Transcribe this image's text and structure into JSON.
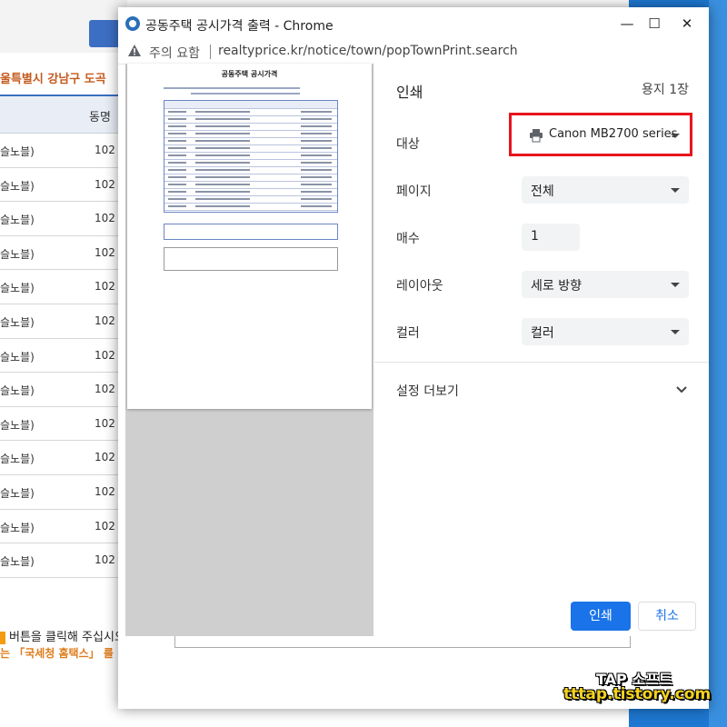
{
  "background_page": {
    "title_fragment": "울특별시 강남구 도곡",
    "table": {
      "header_col2": "동명",
      "rows": [
        {
          "c1": "슬노블)",
          "c2": "102"
        },
        {
          "c1": "슬노블)",
          "c2": "102"
        },
        {
          "c1": "슬노블)",
          "c2": "102"
        },
        {
          "c1": "슬노블)",
          "c2": "102"
        },
        {
          "c1": "슬노블)",
          "c2": "102"
        },
        {
          "c1": "슬노블)",
          "c2": "102"
        },
        {
          "c1": "슬노블)",
          "c2": "102"
        },
        {
          "c1": "슬노블)",
          "c2": "102"
        },
        {
          "c1": "슬노블)",
          "c2": "102"
        },
        {
          "c1": "슬노블)",
          "c2": "102"
        },
        {
          "c1": "슬노블)",
          "c2": "102"
        },
        {
          "c1": "슬노블)",
          "c2": "102"
        },
        {
          "c1": "슬노블)",
          "c2": "102"
        }
      ]
    },
    "note_line1": "버튼을 클릭해 주십시오",
    "note_line2": "는 「국세청 홈택스」 를"
  },
  "window": {
    "title": "공동주택 공시가격 출력 - Chrome",
    "minimize": "—",
    "maximize": "☐",
    "close": "✕"
  },
  "address_bar": {
    "warning": "주의 요함",
    "url": "realtyprice.kr/notice/town/popTownPrint.search"
  },
  "preview": {
    "title": "공동주택 공시가격"
  },
  "print_settings": {
    "heading": "인쇄",
    "sheet_count": "용지 1장",
    "destination_label": "대상",
    "destination_value": "Canon MB2700 series",
    "pages_label": "페이지",
    "pages_value": "전체",
    "copies_label": "매수",
    "copies_value": "1",
    "layout_label": "레이아웃",
    "layout_value": "세로 방향",
    "color_label": "컬러",
    "color_value": "컬러",
    "more_settings": "설정 더보기",
    "print_button": "인쇄",
    "cancel_button": "취소"
  },
  "watermark": {
    "line1": "TAP 소프트",
    "line2": "tttap.tistory.com"
  },
  "colors": {
    "accent": "#1a73e8",
    "highlight_box": "#e8141e",
    "desktop_blue": "#1e78d2"
  }
}
